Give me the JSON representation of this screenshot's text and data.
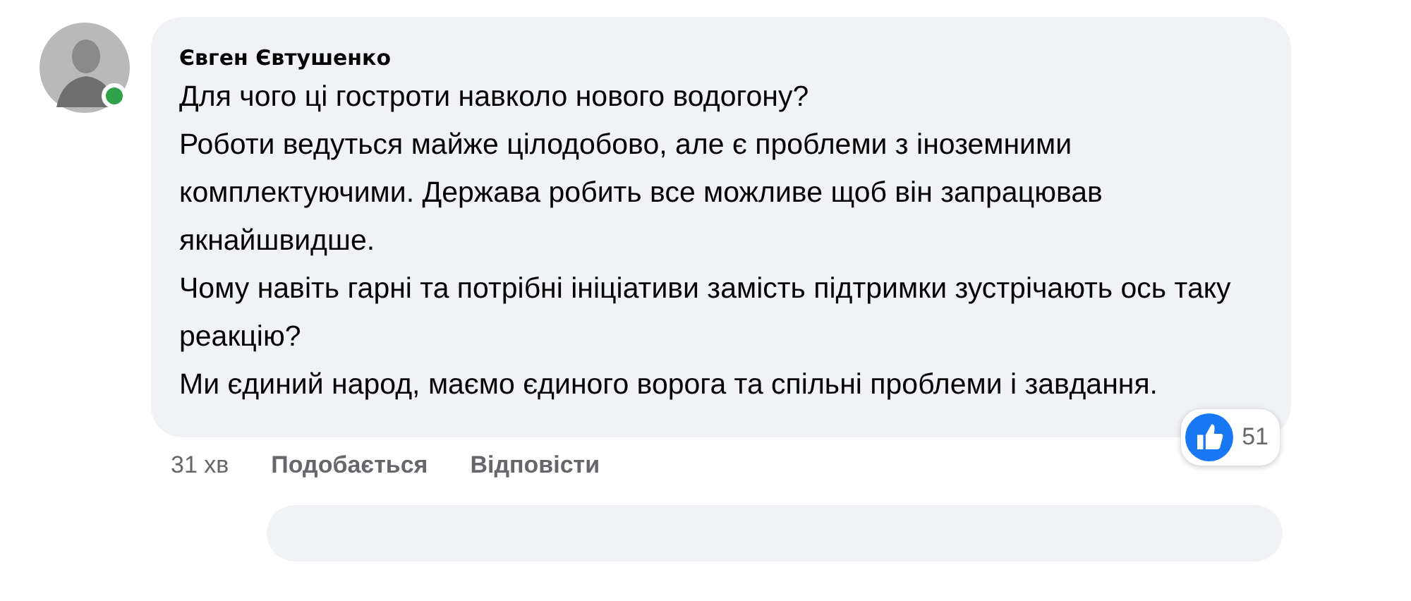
{
  "comment": {
    "author": "Євген Євтушенко",
    "online": true,
    "text": "Для чого ці гостроти навколо нового водогону?\nРоботи ведуться майже цілодобово, але є проблеми з іноземними комплектуючими. Держава робить все можливе щоб він запрацював якнайшвидше.\nЧому навіть гарні та потрібні ініціативи замість підтримки зустрічають ось таку реакцію?\nМи єдиний народ, маємо єдиного ворога та спільні проблеми і завдання.",
    "time": "31 хв",
    "actions": [
      "Подобається",
      "Відповісти"
    ],
    "reactions": {
      "kind": "like",
      "count": "51"
    }
  }
}
